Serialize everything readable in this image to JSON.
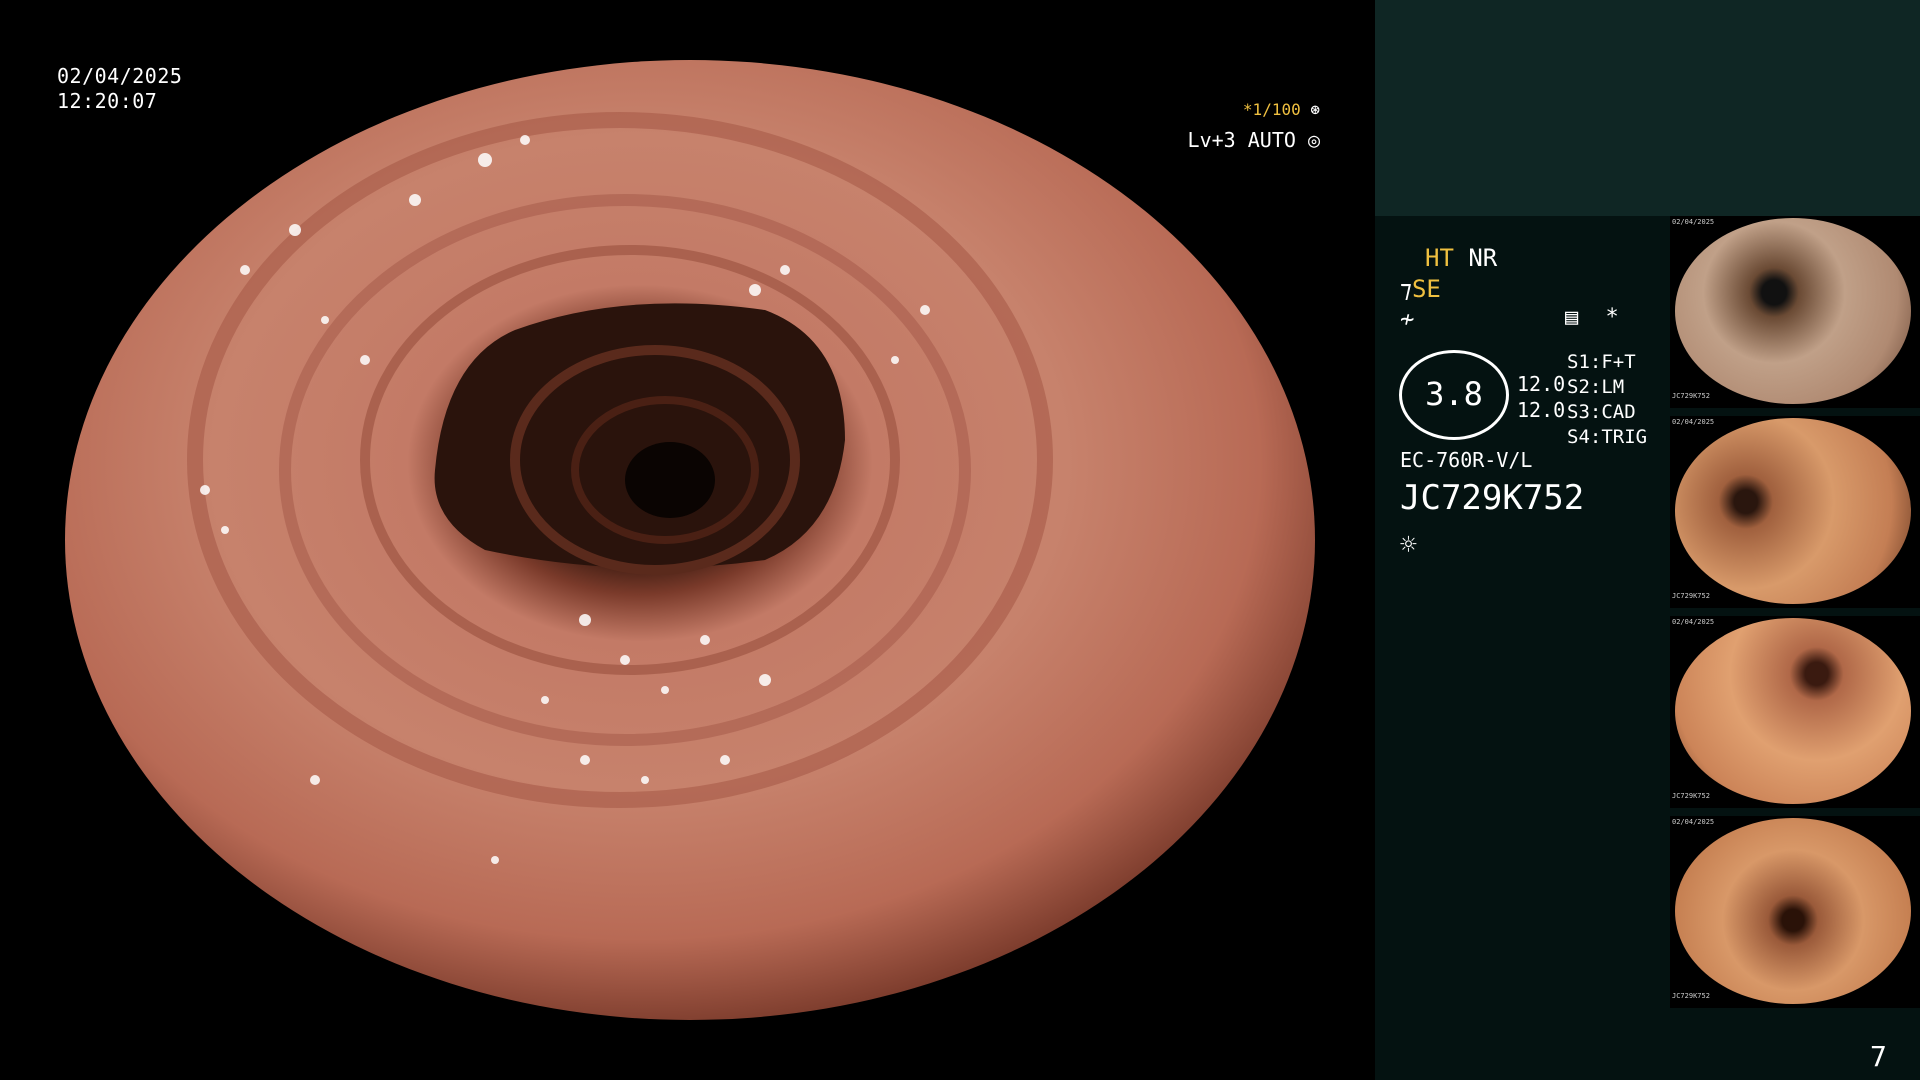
{
  "overlay": {
    "date": "02/04/2025",
    "time": "12:20:07",
    "shutter": "*1/100",
    "level": "Lv+3 AUTO"
  },
  "panel": {
    "mode_ht": "HT",
    "mode_nr": "NR",
    "mode_se": "SE",
    "circle_value": "3.8",
    "value_a": "12.0",
    "value_b": "12.0",
    "switch_1": "S1:F+T",
    "switch_2": "S2:LM",
    "switch_3": "S3:CAD",
    "switch_4": "S4:TRIG",
    "scope_model": "EC-760R-V/L",
    "scope_serial": "JC729K752"
  },
  "thumbnails": [
    {
      "date": "02/04/2025",
      "serial": "JC729K752"
    },
    {
      "date": "02/04/2025",
      "serial": "JC729K752"
    },
    {
      "date": "02/04/2025",
      "serial": "JC729K752"
    },
    {
      "date": "02/04/2025",
      "serial": "JC729K752"
    }
  ],
  "page_number": "7",
  "colors": {
    "panel_bg": "#041211",
    "top_block": "#0f2624",
    "accent_yellow": "#f0c040",
    "mucosa": "#c0705c"
  }
}
